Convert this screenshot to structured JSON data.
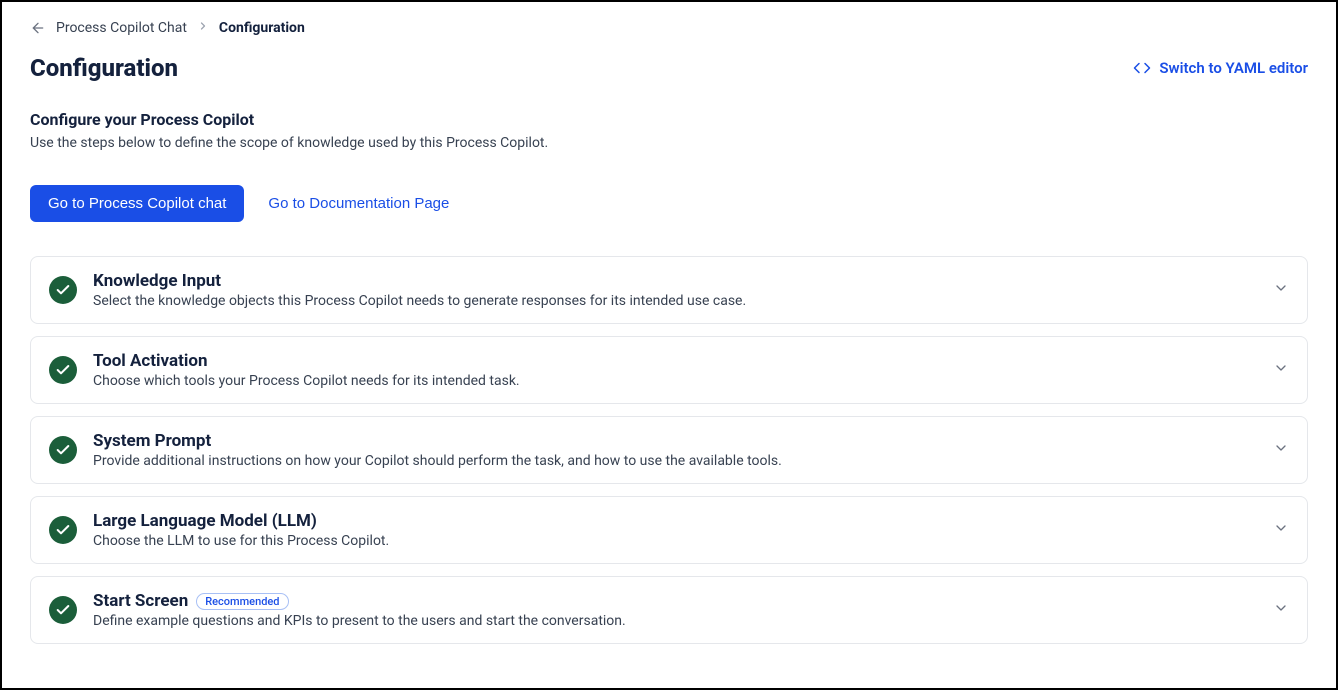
{
  "breadcrumb": {
    "parent": "Process Copilot Chat",
    "current": "Configuration"
  },
  "header": {
    "title": "Configuration",
    "yaml_link": "Switch to YAML editor"
  },
  "intro": {
    "subtitle": "Configure your Process Copilot",
    "description": "Use the steps below to define the scope of knowledge used by this Process Copilot."
  },
  "actions": {
    "primary": "Go to Process Copilot chat",
    "docs": "Go to Documentation Page"
  },
  "sections": [
    {
      "title": "Knowledge Input",
      "description": "Select the knowledge objects this Process Copilot needs to generate responses for its intended use case.",
      "badge": null
    },
    {
      "title": "Tool Activation",
      "description": "Choose which tools your Process Copilot needs for its intended task.",
      "badge": null
    },
    {
      "title": "System Prompt",
      "description": "Provide additional instructions on how your Copilot should perform the task, and how to use the available tools.",
      "badge": null
    },
    {
      "title": "Large Language Model (LLM)",
      "description": "Choose the LLM to use for this Process Copilot.",
      "badge": null
    },
    {
      "title": "Start Screen",
      "description": "Define example questions and KPIs to present to the users and start the conversation.",
      "badge": "Recommended"
    }
  ]
}
